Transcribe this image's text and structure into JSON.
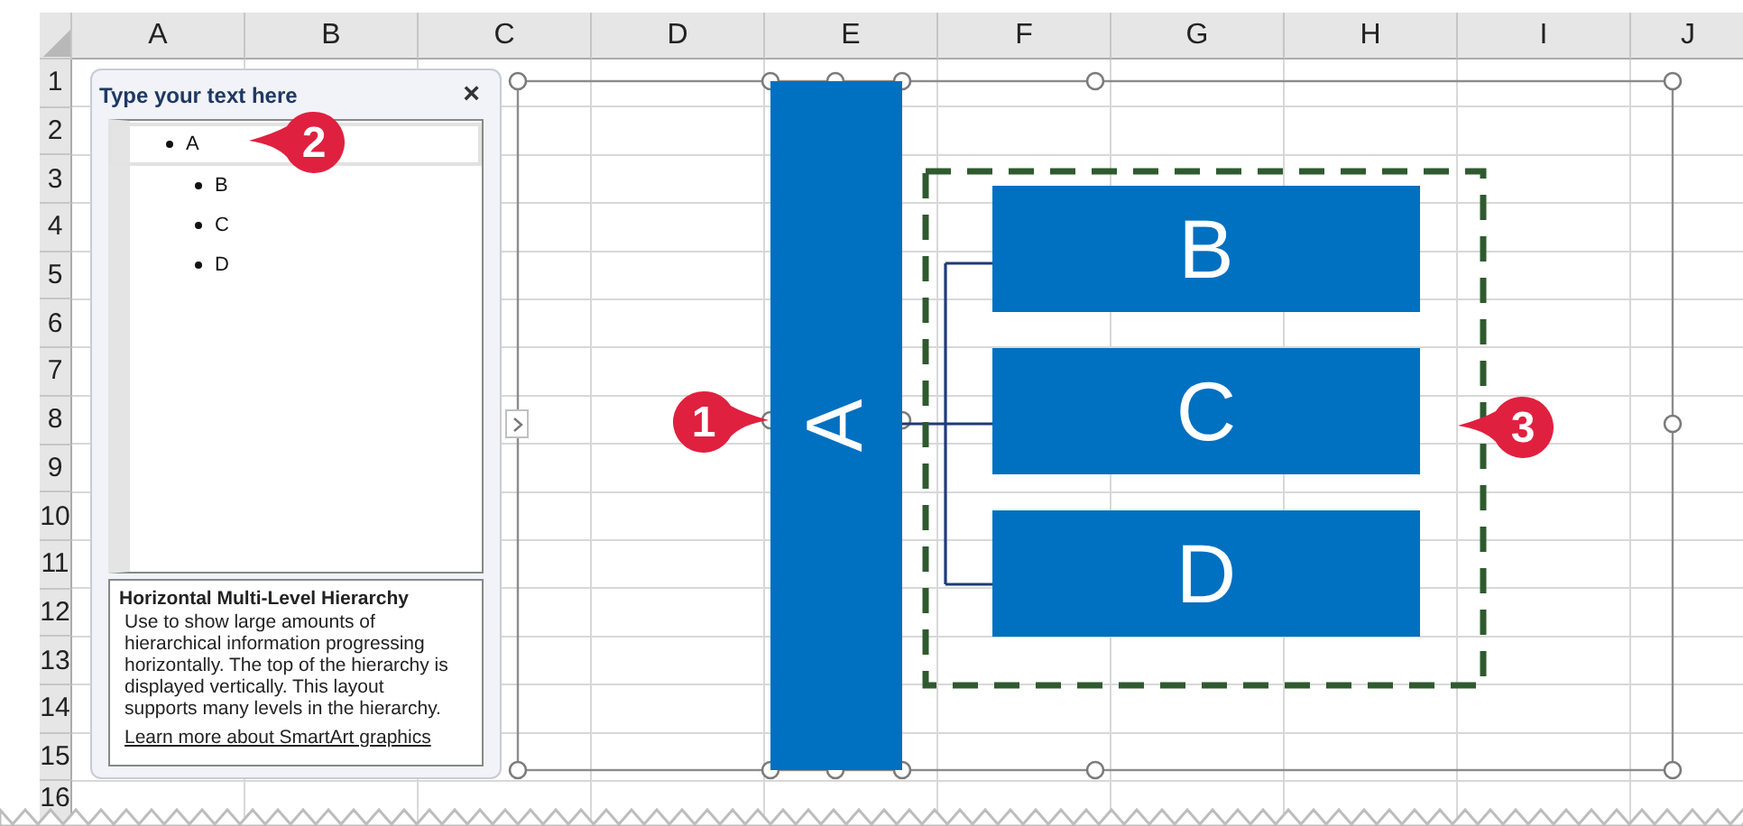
{
  "columns": [
    "A",
    "B",
    "C",
    "D",
    "E",
    "F",
    "G",
    "H",
    "I",
    "J"
  ],
  "rows": [
    "1",
    "2",
    "3",
    "4",
    "5",
    "6",
    "7",
    "8",
    "9",
    "10",
    "11",
    "12",
    "13",
    "14",
    "15",
    "16"
  ],
  "text_pane": {
    "title": "Type your text here",
    "close": "×",
    "items": [
      {
        "text": "A",
        "selected": true,
        "children": [
          {
            "text": "B",
            "selected": false
          },
          {
            "text": "C",
            "selected": false
          },
          {
            "text": "D",
            "selected": false
          }
        ]
      }
    ],
    "description": {
      "title": "Horizontal Multi-Level Hierarchy",
      "body": "Use to show large amounts of hierarchical information progressing horizontally. The top of the hierarchy is displayed vertically. This layout supports many levels in the hierarchy.",
      "link": "Learn more about SmartArt graphics"
    }
  },
  "smartart": {
    "root": "A",
    "children": [
      "B",
      "C",
      "D"
    ]
  },
  "callouts": [
    {
      "number": "1"
    },
    {
      "number": "2"
    },
    {
      "number": "3"
    }
  ]
}
